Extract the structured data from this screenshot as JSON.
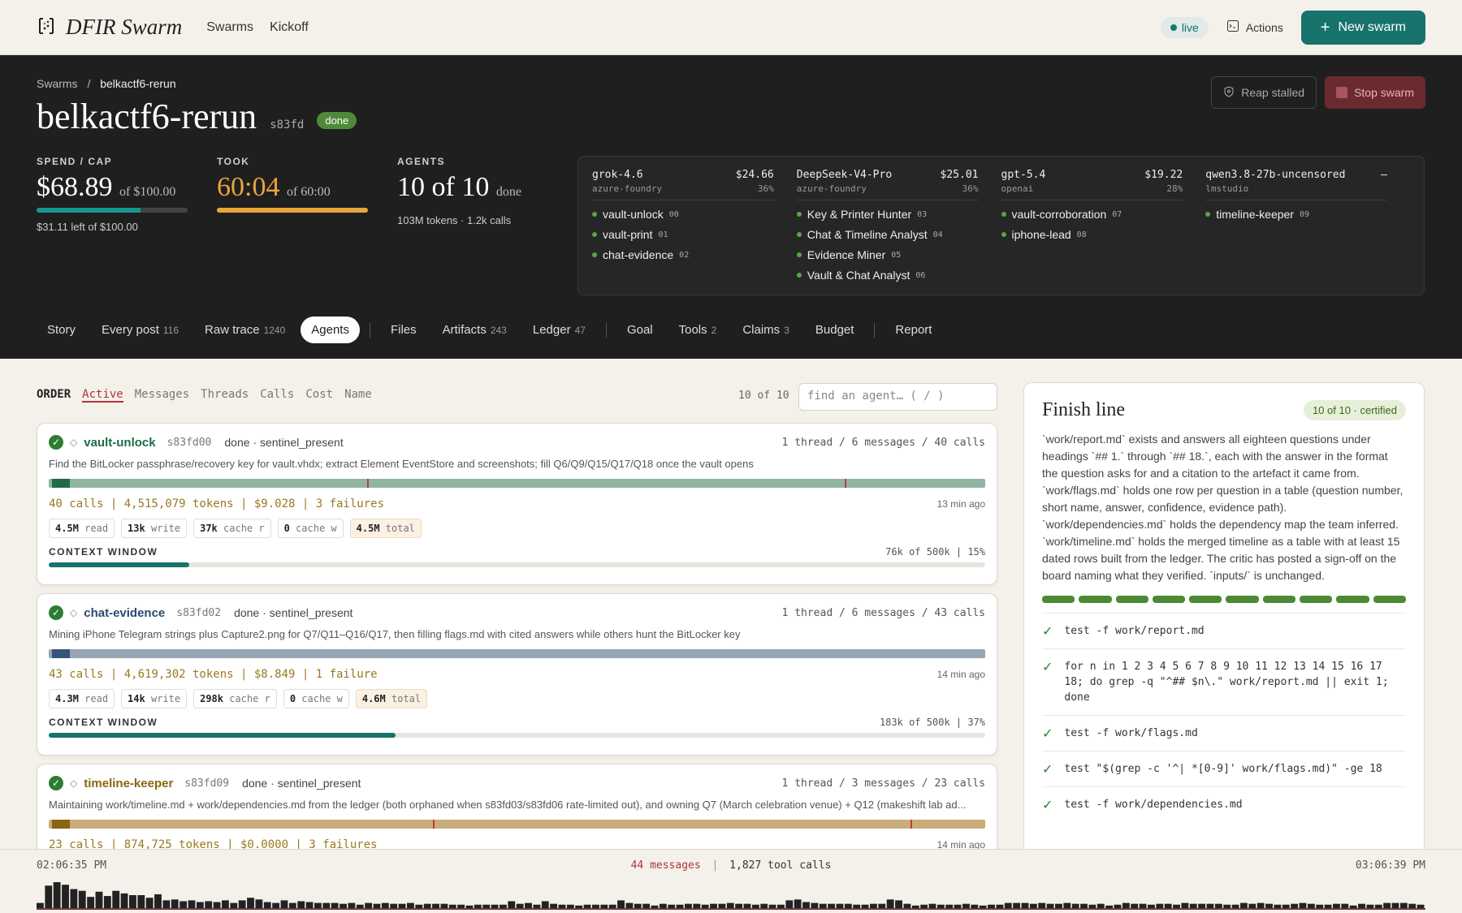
{
  "nav": {
    "brand": "DFIR Swarm",
    "links": [
      "Swarms",
      "Kickoff"
    ],
    "live": "live",
    "actions": "Actions",
    "new_swarm": "New swarm"
  },
  "hero": {
    "breadcrumb_root": "Swarms",
    "breadcrumb_sep": "/",
    "breadcrumb_current": "belkactf6-rerun",
    "title": "belkactf6-rerun",
    "id": "s83fd",
    "status": "done",
    "reap": "Reap stalled",
    "stop": "Stop swarm",
    "stats": {
      "spend_label": "SPEND / CAP",
      "spend_value": "$68.89",
      "spend_of": "of $100.00",
      "spend_fraction": 0.6889,
      "spend_sub": "$31.11 left of $100.00",
      "took_label": "TOOK",
      "took_value": "60:04",
      "took_of": "of 60:00",
      "took_fraction": 1.0,
      "agents_label": "AGENTS",
      "agents_value": "10 of 10",
      "agents_state": "done",
      "agents_sub": "103M tokens · 1.2k calls"
    },
    "models": [
      {
        "name": "grok-4.6",
        "cost": "$24.66",
        "provider": "azure-foundry",
        "pct": "36%",
        "agents": [
          {
            "label": "vault-unlock",
            "num": "00"
          },
          {
            "label": "vault-print",
            "num": "01"
          },
          {
            "label": "chat-evidence",
            "num": "02"
          }
        ]
      },
      {
        "name": "DeepSeek-V4-Pro",
        "cost": "$25.01",
        "provider": "azure-foundry",
        "pct": "36%",
        "agents": [
          {
            "label": "Key & Printer Hunter",
            "num": "03"
          },
          {
            "label": "Chat & Timeline Analyst",
            "num": "04"
          },
          {
            "label": "Evidence Miner",
            "num": "05"
          },
          {
            "label": "Vault & Chat Analyst",
            "num": "06"
          }
        ]
      },
      {
        "name": "gpt-5.4",
        "cost": "$19.22",
        "provider": "openai",
        "pct": "28%",
        "agents": [
          {
            "label": "vault-corroboration",
            "num": "07"
          },
          {
            "label": "iphone-lead",
            "num": "08"
          }
        ]
      },
      {
        "name": "qwen3.8-27b-uncensored",
        "cost": "–",
        "provider": "lmstudio",
        "pct": "",
        "agents": [
          {
            "label": "timeline-keeper",
            "num": "09"
          }
        ]
      }
    ],
    "tabs": [
      {
        "label": "Story",
        "count": ""
      },
      {
        "label": "Every post",
        "count": "116"
      },
      {
        "label": "Raw trace",
        "count": "1240"
      },
      {
        "label": "Agents",
        "count": ""
      },
      {
        "label": "Files",
        "count": ""
      },
      {
        "label": "Artifacts",
        "count": "243"
      },
      {
        "label": "Ledger",
        "count": "47"
      },
      {
        "label": "Goal",
        "count": ""
      },
      {
        "label": "Tools",
        "count": "2"
      },
      {
        "label": "Claims",
        "count": "3"
      },
      {
        "label": "Budget",
        "count": ""
      },
      {
        "label": "Report",
        "count": ""
      }
    ]
  },
  "order": {
    "label": "ORDER",
    "options": [
      "Active",
      "Messages",
      "Threads",
      "Calls",
      "Cost",
      "Name"
    ],
    "count": "10 of 10",
    "search_placeholder": "find an agent…  ( / )"
  },
  "cards": [
    {
      "name": "vault-unlock",
      "id": "s83fd00",
      "status": "done · sentinel_present",
      "meta": "1 thread / 6 messages / 40 calls",
      "desc": "Find the BitLocker passphrase/recovery key for vault.vhdx; extract Element EventStore and screenshots; fill Q6/Q9/Q15/Q17/Q18 once the vault opens",
      "stats": "40 calls | 4,515,079 tokens | $9.028 | 3 failures",
      "ago": "13 min ago",
      "chips": {
        "read": "4.5M",
        "read_l": "read",
        "write": "13k",
        "write_l": "write",
        "cr": "37k",
        "cr_l": "cache r",
        "cw": "0",
        "cw_l": "cache w",
        "total": "4.5M",
        "total_l": "total"
      },
      "ctx_label": "CONTEXT WINDOW",
      "ctx_value": "76k of 500k | 15%",
      "ctx_fraction": 0.15,
      "name_color": "#1f6b46",
      "bar_color": "#8fb5a2",
      "seg_color": "#1f6b46"
    },
    {
      "name": "chat-evidence",
      "id": "s83fd02",
      "status": "done · sentinel_present",
      "meta": "1 thread / 6 messages / 43 calls",
      "desc": "Mining iPhone Telegram strings plus Capture2.png for Q7/Q11–Q16/Q17, then filling flags.md with cited answers while others hunt the BitLocker key",
      "stats": "43 calls | 4,619,302 tokens | $8.849 | 1 failure",
      "ago": "14 min ago",
      "chips": {
        "read": "4.3M",
        "read_l": "read",
        "write": "14k",
        "write_l": "write",
        "cr": "298k",
        "cr_l": "cache r",
        "cw": "0",
        "cw_l": "cache w",
        "total": "4.6M",
        "total_l": "total"
      },
      "ctx_label": "CONTEXT WINDOW",
      "ctx_value": "183k of 500k | 37%",
      "ctx_fraction": 0.37,
      "name_color": "#2b4a6e",
      "bar_color": "#98a5b3",
      "seg_color": "#34557a"
    },
    {
      "name": "timeline-keeper",
      "id": "s83fd09",
      "status": "done · sentinel_present",
      "meta": "1 thread / 3 messages / 23 calls",
      "desc": "Maintaining work/timeline.md + work/dependencies.md from the ledger (both orphaned when s83fd03/s83fd06 rate-limited out), and owning Q7 (March celebration venue) + Q12 (makeshift lab ad...",
      "stats": "23 calls | 874,725 tokens | $0.0000 | 3 failures",
      "ago": "14 min ago",
      "chips": {
        "read": "",
        "read_l": "",
        "write": "",
        "write_l": "",
        "cr": "",
        "cr_l": "",
        "cw": "",
        "cw_l": "",
        "total": "",
        "total_l": ""
      },
      "ctx_label": "",
      "ctx_value": "",
      "ctx_fraction": 0,
      "name_color": "#8a6410",
      "bar_color": "#c9ad78",
      "seg_color": "#8a6410"
    }
  ],
  "finish": {
    "title": "Finish line",
    "badge": "10 of 10 · certified",
    "text": "`work/report.md` exists and answers all eighteen questions under headings `## 1.` through `## 18.`, each with the answer in the format the question asks for and a citation to the artefact it came from. `work/flags.md` holds one row per question in a table (question number, short name, answer, confidence, evidence path). `work/dependencies.md` holds the dependency map the team inferred. `work/timeline.md` holds the merged timeline as a table with at least 15 dated rows built from the ledger. The critic has posted a sign-off on the board naming what they verified. `inputs/` is unchanged.",
    "segments_done": 10,
    "segments_total": 10,
    "checks": [
      "test -f work/report.md",
      "for n in 1 2 3 4 5 6 7 8 9 10 11 12 13 14 15 16 17 18; do grep -q \"^## $n\\.\" work/report.md || exit 1; done",
      "test -f work/flags.md",
      "test \"$(grep -c '^| *[0-9]' work/flags.md)\" -ge 18",
      "test -f work/dependencies.md"
    ]
  },
  "bottom": {
    "start": "02:06:35 PM",
    "end": "03:06:39 PM",
    "messages": "44 messages",
    "sep": "|",
    "calls": "1,827 tool calls",
    "histogram": [
      6,
      26,
      30,
      27,
      22,
      20,
      13,
      19,
      14,
      20,
      17,
      15,
      15,
      12,
      16,
      9,
      10,
      8,
      9,
      7,
      8,
      7,
      9,
      6,
      9,
      12,
      10,
      7,
      6,
      9,
      6,
      8,
      7,
      6,
      6,
      6,
      5,
      6,
      4,
      6,
      5,
      6,
      5,
      5,
      6,
      4,
      5,
      5,
      5,
      4,
      4,
      3,
      4,
      4,
      4,
      4,
      8,
      5,
      6,
      4,
      8,
      5,
      4,
      4,
      3,
      4,
      4,
      4,
      4,
      9,
      6,
      5,
      5,
      3,
      5,
      4,
      4,
      5,
      5,
      4,
      5,
      5,
      6,
      5,
      5,
      4,
      5,
      4,
      4,
      9,
      10,
      7,
      6,
      5,
      5,
      5,
      5,
      4,
      4,
      5,
      5,
      10,
      9,
      5,
      3,
      4,
      5,
      4,
      4,
      4,
      5,
      4,
      3,
      4,
      4,
      6,
      6,
      6,
      5,
      6,
      5,
      5,
      6,
      5,
      5,
      4,
      5,
      3,
      4,
      6,
      5,
      5,
      4,
      5,
      5,
      4,
      6,
      5,
      5,
      5,
      5,
      4,
      4,
      6,
      5,
      6,
      5,
      4,
      4,
      5,
      6,
      5,
      4,
      4,
      5,
      5,
      3,
      5,
      4,
      4,
      6,
      6,
      6,
      5,
      4
    ]
  }
}
